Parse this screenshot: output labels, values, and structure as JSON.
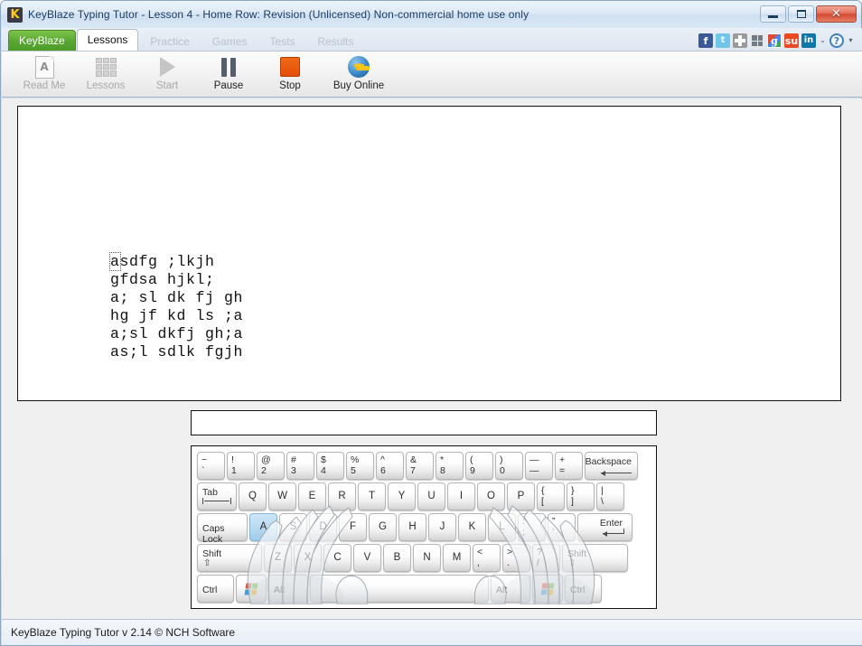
{
  "window": {
    "title": "KeyBlaze Typing Tutor - Lesson 4 - Home Row: Revision (Unlicensed) Non-commercial home use only",
    "app_icon": "keyblaze-k-icon",
    "icon_letter": "K",
    "caption": {
      "minimize": "–",
      "maximize": "□",
      "close": "✕"
    }
  },
  "tabs": [
    {
      "label": "KeyBlaze",
      "state": "brand"
    },
    {
      "label": "Lessons",
      "state": "active"
    },
    {
      "label": "Practice",
      "state": "disabled"
    },
    {
      "label": "Games",
      "state": "disabled"
    },
    {
      "label": "Tests",
      "state": "disabled"
    },
    {
      "label": "Results",
      "state": "disabled"
    }
  ],
  "social": [
    {
      "name": "facebook-icon",
      "glyph": "f"
    },
    {
      "name": "twitter-icon",
      "glyph": "t"
    },
    {
      "name": "google-plus-icon",
      "glyph": ""
    },
    {
      "name": "digg-icon",
      "glyph": ""
    },
    {
      "name": "google-icon",
      "glyph": "g"
    },
    {
      "name": "stumbleupon-icon",
      "glyph": "su"
    },
    {
      "name": "linkedin-icon",
      "glyph": "in"
    },
    {
      "name": "chevron-down-icon",
      "glyph": "⌄"
    },
    {
      "name": "help-icon",
      "glyph": "?"
    },
    {
      "name": "dropdown-arrow-icon",
      "glyph": "▾"
    }
  ],
  "toolbar": [
    {
      "label": "Read Me",
      "icon": "document-a-icon",
      "enabled": false
    },
    {
      "label": "Lessons",
      "icon": "grid-lessons-icon",
      "enabled": false
    },
    {
      "label": "Start",
      "icon": "play-icon",
      "enabled": false
    },
    {
      "label": "Pause",
      "icon": "pause-icon",
      "enabled": true
    },
    {
      "label": "Stop",
      "icon": "stop-icon",
      "enabled": true
    },
    {
      "label": "Buy Online",
      "icon": "globe-key-icon",
      "enabled": true
    }
  ],
  "lesson": {
    "cursor_char": "a",
    "text_after_cursor": "sdfg ;lkjh",
    "lines": [
      "asdfg ;lkjh",
      "gfdsa hjkl;",
      "a; sl dk fj gh",
      "hg jf kd ls ;a",
      "a;sl dkfj gh;a",
      "as;l sdlk fgjh"
    ]
  },
  "typing_input": {
    "value": "",
    "placeholder": ""
  },
  "keyboard": {
    "highlighted_key": "A",
    "rows": [
      [
        {
          "name": "key-backtick",
          "top": "~",
          "bottom": "`",
          "w": ""
        },
        {
          "name": "key-1",
          "top": "!",
          "bottom": "1",
          "w": ""
        },
        {
          "name": "key-2",
          "top": "@",
          "bottom": "2",
          "w": ""
        },
        {
          "name": "key-3",
          "top": "#",
          "bottom": "3",
          "w": ""
        },
        {
          "name": "key-4",
          "top": "$",
          "bottom": "4",
          "w": ""
        },
        {
          "name": "key-5",
          "top": "%",
          "bottom": "5",
          "w": ""
        },
        {
          "name": "key-6",
          "top": "^",
          "bottom": "6",
          "w": ""
        },
        {
          "name": "key-7",
          "top": "&",
          "bottom": "7",
          "w": ""
        },
        {
          "name": "key-8",
          "top": "*",
          "bottom": "8",
          "w": ""
        },
        {
          "name": "key-9",
          "top": "(",
          "bottom": "9",
          "w": ""
        },
        {
          "name": "key-0",
          "top": ")",
          "bottom": "0",
          "w": ""
        },
        {
          "name": "key-minus",
          "top": "—",
          "bottom": "—",
          "w": ""
        },
        {
          "name": "key-equals",
          "top": "+",
          "bottom": "=",
          "w": ""
        },
        {
          "name": "key-backspace",
          "top": "Backspace",
          "bottom": "",
          "w": "w-backspace",
          "style": "wide-arrow-back"
        }
      ],
      [
        {
          "name": "key-tab",
          "top": "Tab",
          "bottom": "",
          "w": "w-tab",
          "style": "wide-tab"
        },
        {
          "name": "key-q",
          "top": "Q",
          "bottom": "",
          "w": "",
          "style": "center"
        },
        {
          "name": "key-w",
          "top": "W",
          "bottom": "",
          "w": "",
          "style": "center"
        },
        {
          "name": "key-e",
          "top": "E",
          "bottom": "",
          "w": "",
          "style": "center"
        },
        {
          "name": "key-r",
          "top": "R",
          "bottom": "",
          "w": "",
          "style": "center"
        },
        {
          "name": "key-t",
          "top": "T",
          "bottom": "",
          "w": "",
          "style": "center"
        },
        {
          "name": "key-y",
          "top": "Y",
          "bottom": "",
          "w": "",
          "style": "center"
        },
        {
          "name": "key-u",
          "top": "U",
          "bottom": "",
          "w": "",
          "style": "center"
        },
        {
          "name": "key-i",
          "top": "I",
          "bottom": "",
          "w": "",
          "style": "center"
        },
        {
          "name": "key-o",
          "top": "O",
          "bottom": "",
          "w": "",
          "style": "center"
        },
        {
          "name": "key-p",
          "top": "P",
          "bottom": "",
          "w": "",
          "style": "center"
        },
        {
          "name": "key-bracket-left",
          "top": "{",
          "bottom": "[",
          "w": ""
        },
        {
          "name": "key-bracket-right",
          "top": "}",
          "bottom": "]",
          "w": ""
        },
        {
          "name": "key-backslash",
          "top": "|",
          "bottom": "\\",
          "w": ""
        }
      ],
      [
        {
          "name": "key-caps-lock",
          "top": "Caps Lock",
          "bottom": "",
          "w": "w-caps",
          "style": "wide-plain"
        },
        {
          "name": "key-a",
          "top": "A",
          "bottom": "",
          "w": "",
          "style": "center",
          "hl": true
        },
        {
          "name": "key-s",
          "top": "S",
          "bottom": "",
          "w": "",
          "style": "center"
        },
        {
          "name": "key-d",
          "top": "D",
          "bottom": "",
          "w": "",
          "style": "center"
        },
        {
          "name": "key-f",
          "top": "F",
          "bottom": "",
          "w": "",
          "style": "center"
        },
        {
          "name": "key-g",
          "top": "G",
          "bottom": "",
          "w": "",
          "style": "center"
        },
        {
          "name": "key-h",
          "top": "H",
          "bottom": "",
          "w": "",
          "style": "center"
        },
        {
          "name": "key-j",
          "top": "J",
          "bottom": "",
          "w": "",
          "style": "center"
        },
        {
          "name": "key-k",
          "top": "K",
          "bottom": "",
          "w": "",
          "style": "center"
        },
        {
          "name": "key-l",
          "top": "L",
          "bottom": "",
          "w": "",
          "style": "center"
        },
        {
          "name": "key-semicolon",
          "top": ":",
          "bottom": ";",
          "w": ""
        },
        {
          "name": "key-quote",
          "top": "”",
          "bottom": "’",
          "w": ""
        },
        {
          "name": "key-enter",
          "top": "Enter",
          "bottom": "",
          "w": "w-enter",
          "style": "wide-arrow-enter"
        }
      ],
      [
        {
          "name": "key-shift-left",
          "top": "Shift",
          "bottom": "",
          "w": "w-shiftl",
          "style": "wide-shift"
        },
        {
          "name": "key-z",
          "top": "Z",
          "bottom": "",
          "w": "",
          "style": "center"
        },
        {
          "name": "key-x",
          "top": "X",
          "bottom": "",
          "w": "",
          "style": "center"
        },
        {
          "name": "key-c",
          "top": "C",
          "bottom": "",
          "w": "",
          "style": "center"
        },
        {
          "name": "key-v",
          "top": "V",
          "bottom": "",
          "w": "",
          "style": "center"
        },
        {
          "name": "key-b",
          "top": "B",
          "bottom": "",
          "w": "",
          "style": "center"
        },
        {
          "name": "key-n",
          "top": "N",
          "bottom": "",
          "w": "",
          "style": "center"
        },
        {
          "name": "key-m",
          "top": "M",
          "bottom": "",
          "w": "",
          "style": "center"
        },
        {
          "name": "key-comma",
          "top": "<",
          "bottom": ",",
          "w": ""
        },
        {
          "name": "key-period",
          "top": ">",
          "bottom": ".",
          "w": ""
        },
        {
          "name": "key-slash",
          "top": "?",
          "bottom": "/",
          "w": ""
        },
        {
          "name": "key-shift-right",
          "top": "Shift",
          "bottom": "",
          "w": "w-shiftr",
          "style": "wide-shift"
        }
      ],
      [
        {
          "name": "key-ctrl-left",
          "top": "Ctrl",
          "bottom": "",
          "w": "w-ctrl",
          "style": "wide-plain"
        },
        {
          "name": "key-windows-left",
          "top": "",
          "bottom": "",
          "w": "w-win",
          "style": "winlogo"
        },
        {
          "name": "key-alt-left",
          "top": "Alt",
          "bottom": "",
          "w": "w-alt",
          "style": "wide-plain"
        },
        {
          "name": "key-space",
          "top": "",
          "bottom": "",
          "w": "w-space",
          "style": "plain"
        },
        {
          "name": "key-alt-right",
          "top": "Alt",
          "bottom": "",
          "w": "w-alt",
          "style": "wide-plain"
        },
        {
          "name": "key-windows-right",
          "top": "",
          "bottom": "",
          "w": "w-win",
          "style": "winlogo"
        },
        {
          "name": "key-ctrl-right",
          "top": "Ctrl",
          "bottom": "",
          "w": "w-ctrl",
          "style": "wide-plain"
        }
      ]
    ]
  },
  "statusbar": {
    "text": "KeyBlaze Typing Tutor v 2.14 © NCH Software"
  },
  "colors": {
    "brand_green": "#58a731",
    "highlight_key": "#9fcbea",
    "stop_orange": "#e34f07",
    "title_text": "#1c3c63"
  }
}
